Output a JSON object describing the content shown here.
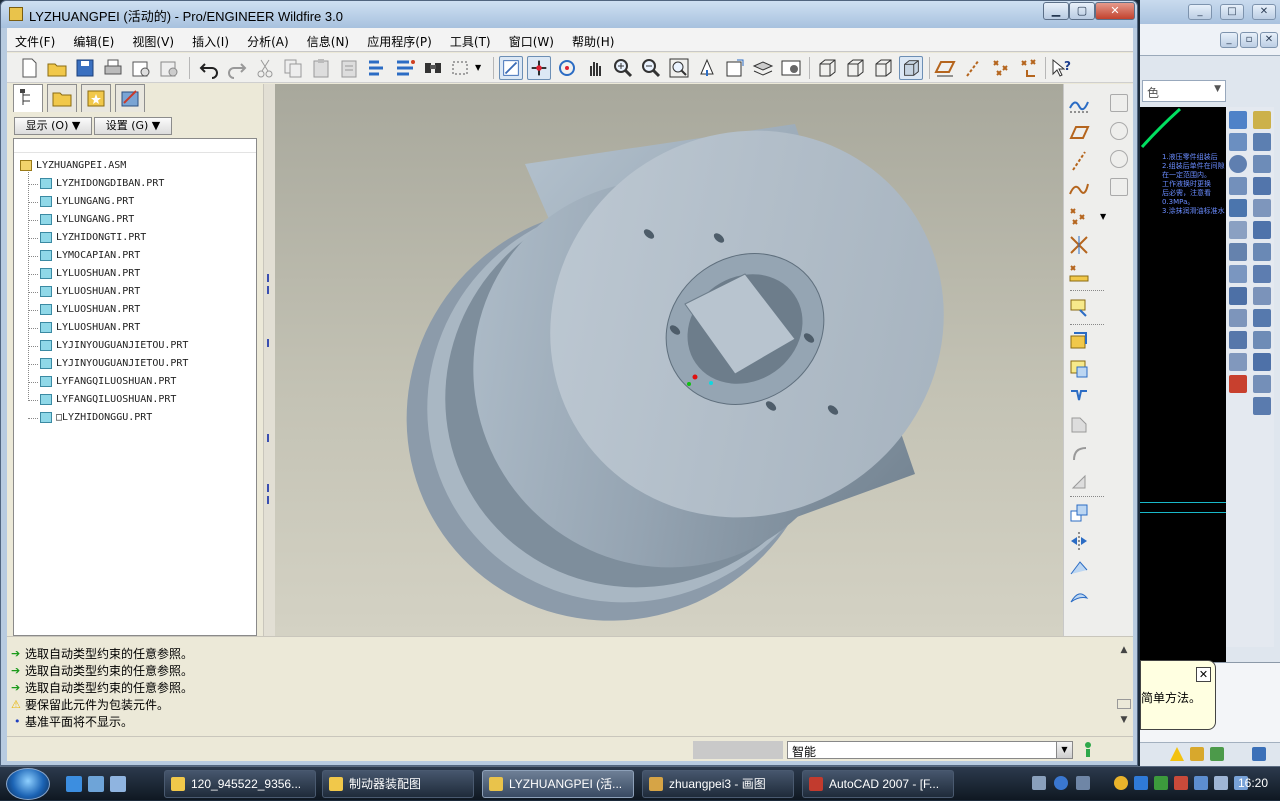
{
  "window": {
    "title": "LYZHUANGPEI (活动的) - Pro/ENGINEER Wildfire 3.0",
    "controls": [
      "minimize",
      "maximize",
      "close"
    ]
  },
  "menubar": {
    "items": [
      {
        "label": "文件(F)"
      },
      {
        "label": "编辑(E)"
      },
      {
        "label": "视图(V)"
      },
      {
        "label": "插入(I)"
      },
      {
        "label": "分析(A)"
      },
      {
        "label": "信息(N)"
      },
      {
        "label": "应用程序(P)"
      },
      {
        "label": "工具(T)"
      },
      {
        "label": "窗口(W)"
      },
      {
        "label": "帮助(H)"
      }
    ]
  },
  "toolbar": {
    "icons": [
      "new-icon",
      "open-icon",
      "save-icon",
      "print-icon",
      "save-copy-icon",
      "send-icon",
      "undo-icon",
      "redo-icon",
      "cut-icon",
      "copy-icon",
      "paste-icon",
      "paste-special-icon",
      "regenerate-icon",
      "regen-manager-icon",
      "find-icon",
      "select-box-icon",
      "repaint-icon",
      "spin-center-icon",
      "orient-mode-icon",
      "pan-icon",
      "zoom-in-icon",
      "zoom-out-icon",
      "refit-icon",
      "reorient-icon",
      "saved-views-icon",
      "layers-icon",
      "view-manager-icon",
      "wireframe-icon",
      "hidden-line-icon",
      "no-hidden-icon",
      "shading-icon",
      "datum-plane-display-icon",
      "datum-axis-display-icon",
      "datum-point-display-icon",
      "csys-display-icon",
      "context-help-icon"
    ]
  },
  "navigator": {
    "tabs": [
      "model-tree-tab",
      "folder-browser-tab",
      "favorites-tab",
      "connections-tab"
    ],
    "show_button": "显示 (O)",
    "settings_button": "设置 (G)",
    "tree": {
      "root": "LYZHUANGPEI.ASM",
      "items": [
        "LYZHIDONGDIBAN.PRT",
        "LYLUNGANG.PRT",
        "LYLUNGANG.PRT",
        "LYZHIDONGTI.PRT",
        "LYMOCAPIAN.PRT",
        "LYLUOSHUAN.PRT",
        "LYLUOSHUAN.PRT",
        "LYLUOSHUAN.PRT",
        "LYLUOSHUAN.PRT",
        "LYJINYOUGUANJIETOU.PRT",
        "LYJINYOUGUANJIETOU.PRT",
        "LYFANGQILUOSHUAN.PRT",
        "LYFANGQILUOSHUAN.PRT",
        "□LYZHIDONGGU.PRT"
      ]
    }
  },
  "messages": [
    {
      "type": "prompt",
      "text": "选取自动类型约束的任意参照。"
    },
    {
      "type": "prompt",
      "text": "选取自动类型约束的任意参照。"
    },
    {
      "type": "prompt",
      "text": "选取自动类型约束的任意参照。"
    },
    {
      "type": "warning",
      "text": "要保留此元件为包装元件。"
    },
    {
      "type": "info",
      "text": "基准平面将不显示。"
    }
  ],
  "status": {
    "filter_value": "智能"
  },
  "background_window": {
    "balloon_text": "简单方法。",
    "layer_combo": "色",
    "cad_note_lines": [
      "1.液压零件组装后",
      "2.组装后单件在间隙",
      "  在一定范围内。",
      "  工作液换时更换",
      "  后必需，注意看",
      "  0.3MPa。",
      "3.涂抹润滑油标准水"
    ]
  },
  "taskbar": {
    "tasks": [
      {
        "label": "120_945522_9356...",
        "active": false
      },
      {
        "label": "制动器装配图",
        "active": false
      },
      {
        "label": "LYZHUANGPEI (活...",
        "active": true
      },
      {
        "label": "zhuangpei3 - 画图",
        "active": false
      },
      {
        "label": "AutoCAD 2007 - [F...",
        "active": false
      }
    ],
    "clock": "16:20"
  },
  "colors": {
    "model_body": "#a6b4c0",
    "graphics_bg_top": "#a8a89c",
    "graphics_bg_bottom": "#d4d2c4",
    "prompt_arrow": "#1a9a1a",
    "warning": "#e8b400",
    "info_dot": "#2040c0"
  }
}
